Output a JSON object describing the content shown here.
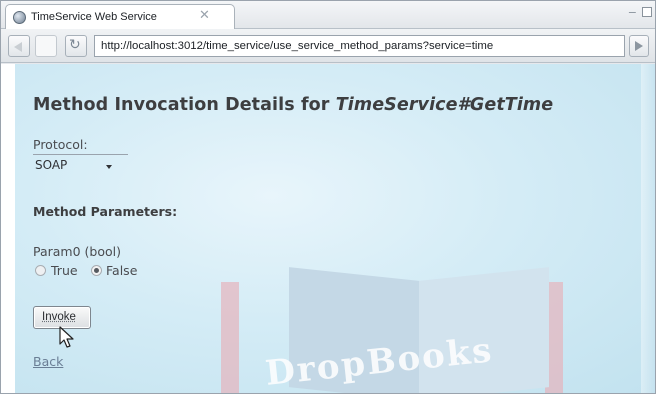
{
  "tab": {
    "title": "TimeService Web Service",
    "close": "✕"
  },
  "window_controls": {
    "minimize": "−"
  },
  "toolbar": {
    "url": "http://localhost:3012/time_service/use_service_method_params?service=time"
  },
  "page": {
    "heading_prefix": "Method Invocation Details for ",
    "heading_method": "TimeService#GetTime",
    "protocol_label": "Protocol:",
    "protocol_value": "SOAP",
    "section_title": "Method Parameters:",
    "param_label": "Param0 (bool)",
    "radio_true": "True",
    "radio_false": "False",
    "selected": "False",
    "invoke_label": "Invoke",
    "back_label": "Back"
  },
  "watermark": {
    "text": "DropBooks"
  },
  "icons": [
    "globe-icon",
    "back-arrow-icon",
    "forward-icon",
    "refresh-icon",
    "go-icon",
    "mouse-cursor-icon"
  ]
}
